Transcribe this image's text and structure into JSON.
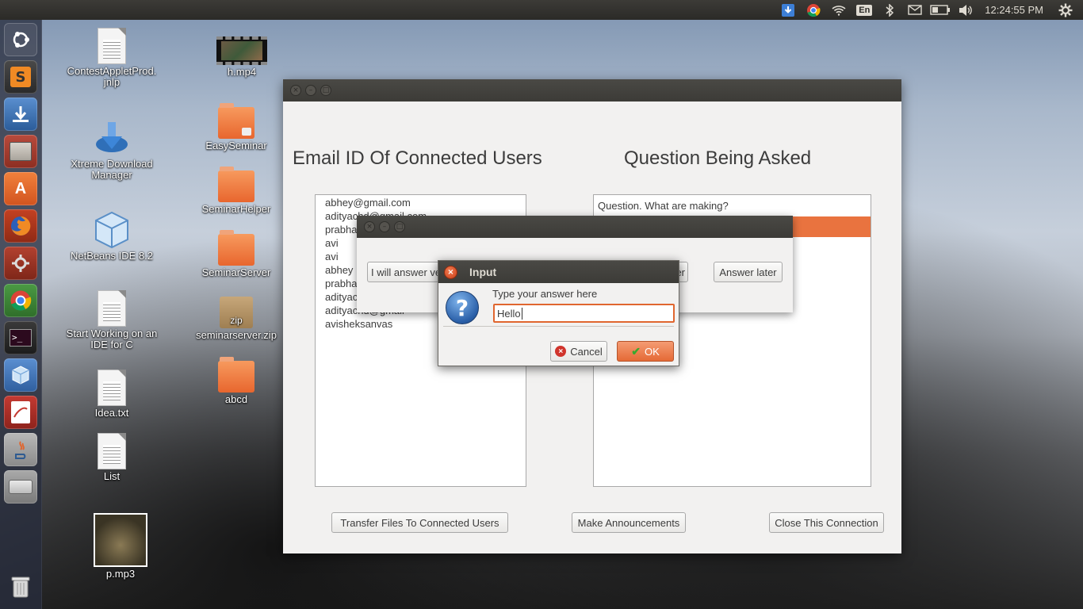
{
  "top_panel": {
    "clock": "12:24:55 PM",
    "lang": "En",
    "tray_icons": [
      "download-indicator-icon",
      "chrome-icon",
      "wifi-icon",
      "keyboard-lang-icon",
      "bluetooth-icon",
      "mail-icon",
      "battery-icon",
      "volume-icon",
      "settings-gear-icon"
    ]
  },
  "launcher": {
    "items": [
      "ubuntu-dash",
      "sublime-text",
      "xtreme-download-manager",
      "file-manager",
      "ubuntu-software",
      "firefox",
      "system-settings",
      "chrome",
      "terminal",
      "netbeans",
      "document-viewer",
      "java",
      "disk-drive",
      "trash"
    ]
  },
  "desktop": {
    "icons": [
      {
        "label": "ContestAppletProd.\njnlp"
      },
      {
        "label": "h.mp4"
      },
      {
        "label": "Xtreme Download\nManager"
      },
      {
        "label": "EasySeminar"
      },
      {
        "label": "SeminarHelper"
      },
      {
        "label": "NetBeans IDE 8.2"
      },
      {
        "label": "SeminarServer"
      },
      {
        "label": "Start Working on an\nIDE for C"
      },
      {
        "label": "seminarserver.zip"
      },
      {
        "label": "Idea.txt"
      },
      {
        "label": "abcd"
      },
      {
        "label": "List"
      },
      {
        "label": "p.mp3"
      }
    ],
    "zip_badge": "zip"
  },
  "main_window": {
    "users_heading": "Email ID Of Connected Users",
    "questions_heading": "Question Being Asked",
    "users": [
      "abhey@gmail.com",
      "adityachd@gmail.com",
      "prabha",
      "avi",
      "avi",
      "abhey",
      "prabha",
      "adityac",
      "adityachd@gmail",
      "avisheksanvas"
    ],
    "questions": [
      "Question. What are making?"
    ],
    "buttons": {
      "transfer": "Transfer Files To Connected Users",
      "announce": "Make Announcements",
      "close": "Close This Connection"
    }
  },
  "choice_dialog": {
    "answer_now": "I will answer ve",
    "answer_mid": "er",
    "answer_later": "Answer later"
  },
  "input_dialog": {
    "title": "Input",
    "prompt": "Type your answer here",
    "value": "Hello",
    "cancel": "Cancel",
    "ok": "OK"
  },
  "colors": {
    "accent": "#e56a36",
    "panel": "#3c3b37",
    "window_bg": "#f2f1f0"
  }
}
